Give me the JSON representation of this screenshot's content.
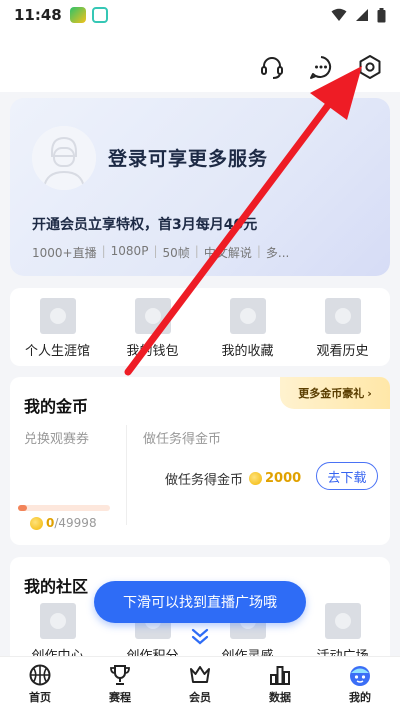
{
  "status_bar": {
    "time": "11:48",
    "app_icons": [
      "app-icon-1",
      "app-icon-2"
    ],
    "right_icons": [
      "wifi-icon",
      "signal-icon",
      "battery-icon"
    ]
  },
  "top_bar": {
    "icons": [
      "customer-service-icon",
      "message-icon",
      "settings-icon"
    ]
  },
  "vip_card": {
    "login_text": "登录可享更多服务",
    "promo": "开通会员立享特权，首3月每月40元",
    "features": [
      "1000+直播",
      "1080P",
      "50帧",
      "中文解说",
      "多..."
    ]
  },
  "quick_entries": [
    {
      "label": "个人生涯馆"
    },
    {
      "label": "我的钱包"
    },
    {
      "label": "我的收藏"
    },
    {
      "label": "观看历史"
    }
  ],
  "coins": {
    "title": "我的金币",
    "gift_button": "更多金币豪礼",
    "tab_left": "兑换观赛券",
    "tab_right": "做任务得金币",
    "task_text": "做任务得金币",
    "task_amount": "2000",
    "download_button": "去下载",
    "progress_current": "0",
    "progress_total": "/49998",
    "progress_fraction": 0.0
  },
  "community": {
    "title": "我的社区",
    "items": [
      {
        "label": "创作中心"
      },
      {
        "label": "创作积分"
      },
      {
        "label": "创作灵感"
      },
      {
        "label": "活动广场"
      }
    ]
  },
  "toast": {
    "text": "下滑可以找到直播广场哦"
  },
  "tab_bar": {
    "tabs": [
      {
        "label": "首页",
        "icon": "basketball-icon"
      },
      {
        "label": "赛程",
        "icon": "trophy-icon"
      },
      {
        "label": "会员",
        "icon": "crown-icon"
      },
      {
        "label": "数据",
        "icon": "bar-chart-icon"
      },
      {
        "label": "我的",
        "icon": "profile-mascot-icon",
        "active": true
      }
    ]
  },
  "annotation": {
    "arrow_color": "#ee1c25",
    "points_to": "settings-icon"
  },
  "colors": {
    "accent": "#2e6cf6",
    "coin_gold": "#e0a100",
    "progress": "#f2845a",
    "annotation_red": "#ee1c25"
  }
}
